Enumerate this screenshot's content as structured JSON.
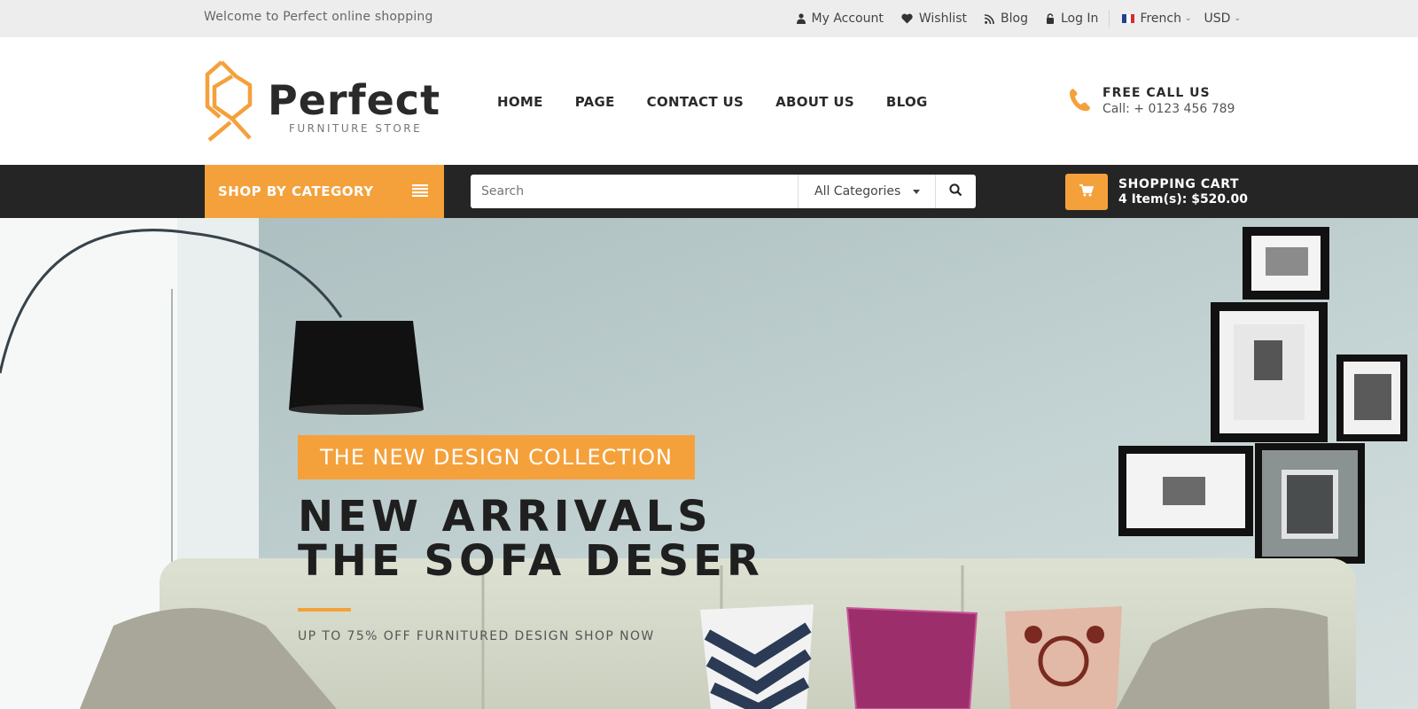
{
  "topbar": {
    "welcome": "Welcome to Perfect online shopping",
    "links": {
      "account": "My Account",
      "wishlist": "Wishlist",
      "blog": "Blog",
      "login": "Log In"
    },
    "language": "French",
    "currency": "USD"
  },
  "header": {
    "logo_name": "Perfect",
    "logo_sub": "FURNITURE STORE",
    "nav": [
      "HOME",
      "PAGE",
      "CONTACT US",
      "ABOUT US",
      "BLOG"
    ],
    "call_title": "FREE CALL US",
    "call_number": "Call: + 0123 456 789"
  },
  "catbar": {
    "shop_by_category": "SHOP BY CATEGORY",
    "search_placeholder": "Search",
    "category_select": "All Categories",
    "cart_title": "SHOPPING CART",
    "cart_summary": "4 Item(s): $520.00"
  },
  "hero": {
    "tag": "THE NEW DESIGN COLLECTION",
    "title_line1": "NEW ARRIVALS",
    "title_line2": "THE SOFA DESER",
    "subtitle": "UP TO 75% OFF FURNITURED DESIGN SHOP NOW"
  },
  "colors": {
    "accent": "#f4a13b",
    "dark_bar": "#252525",
    "topbar_bg": "#ededed"
  },
  "icons": {
    "account": "user-icon",
    "wishlist": "heart-icon",
    "blog": "rss-icon",
    "login": "lock-icon",
    "phone": "phone-icon",
    "menu": "menu-icon",
    "search": "search-icon",
    "cart": "cart-icon"
  }
}
